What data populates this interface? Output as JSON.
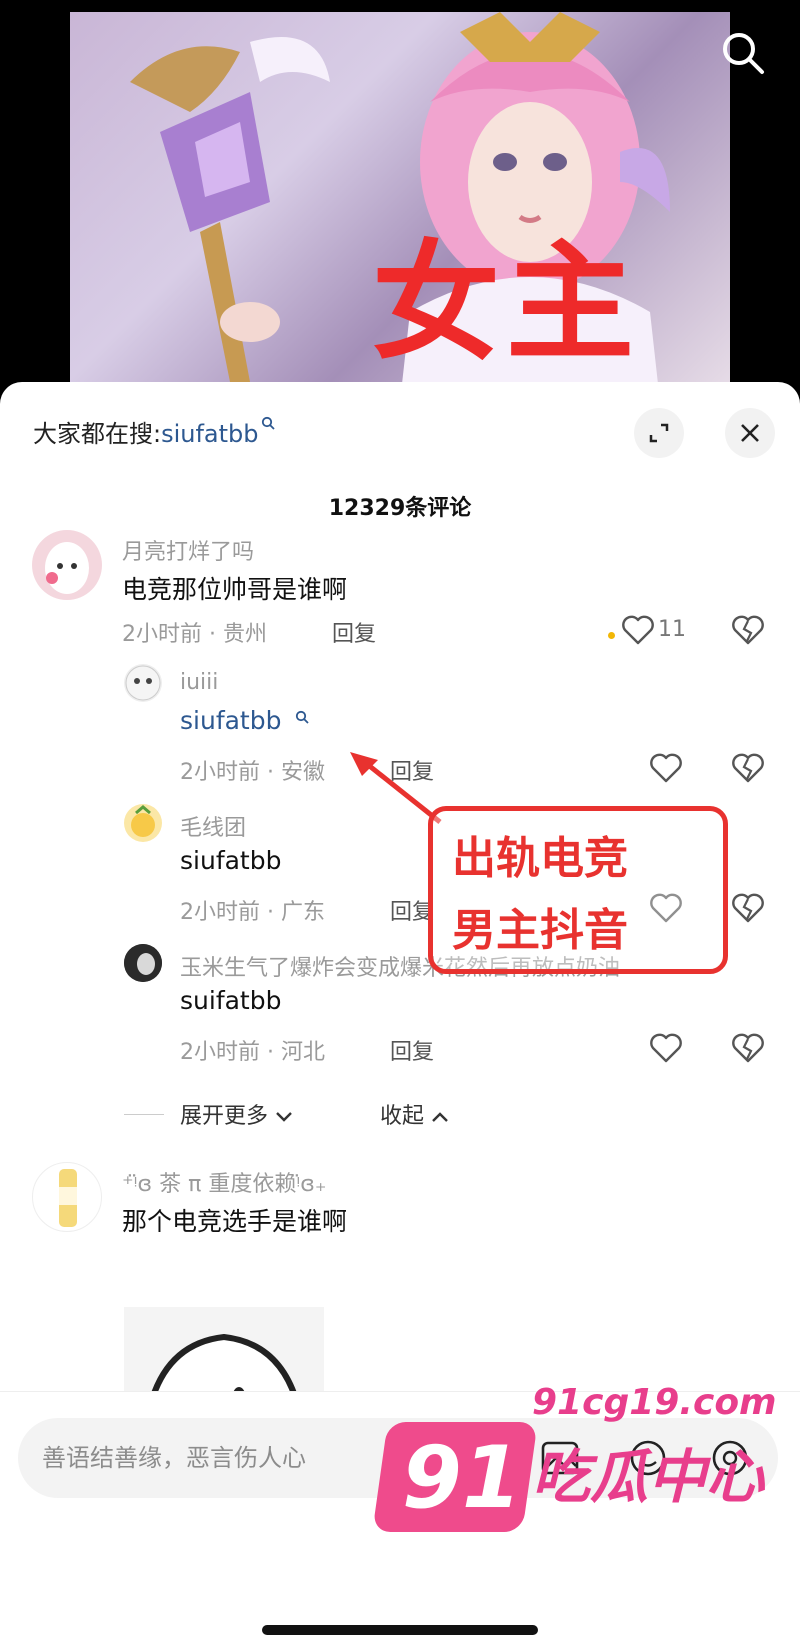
{
  "video": {
    "overlay_text": "女主"
  },
  "sheet": {
    "hot_search_prefix": "大家都在搜:",
    "hot_search_term": "siufatbb",
    "comment_count": "12329条评论"
  },
  "comments": [
    {
      "user": "月亮打烊了吗",
      "text": "电竞那位帅哥是谁啊",
      "meta": "2小时前 · 贵州",
      "reply": "回复",
      "likes": "11"
    },
    {
      "user": "iuiii",
      "text": "siufatbb",
      "meta": "2小时前 · 安徽",
      "reply": "回复"
    },
    {
      "user": "毛线团",
      "text": "siufatbb",
      "meta": "2小时前 · 广东",
      "reply": "回复"
    },
    {
      "user": "玉米生气了爆炸会变成爆米花然后再放点奶油",
      "text": "suifatbb",
      "meta": "2小时前 · 河北",
      "reply": "回复"
    },
    {
      "user": "⁺ᵎ̈ɞ 茶 π 重度依赖ᵎ̈ɞ₊",
      "text": "那个电竞选手是谁啊"
    }
  ],
  "expand": {
    "more": "展开更多",
    "collapse": "收起"
  },
  "annotation": {
    "line1": "出轨电竞",
    "line2": "男主抖音"
  },
  "input": {
    "placeholder": "善语结善缘，恶言伤人心"
  },
  "watermark": {
    "number": "91",
    "domain": "91cg19.com",
    "name": "吃瓜中心"
  },
  "colors": {
    "link": "#2d5890",
    "annotation": "#e8322f",
    "watermark": "#e83e8c"
  }
}
